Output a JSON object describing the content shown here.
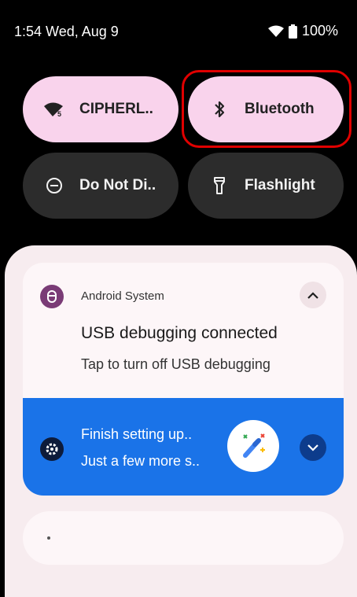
{
  "status_bar": {
    "time": "1:54 Wed, Aug 9",
    "battery": "100%",
    "icons": [
      "wifi-icon",
      "battery-icon"
    ]
  },
  "quick_settings": [
    {
      "label": "CIPHERL..",
      "icon": "wifi-icon",
      "state": "on"
    },
    {
      "label": "Bluetooth",
      "icon": "bluetooth-icon",
      "state": "on"
    },
    {
      "label": "Do Not Di..",
      "icon": "do-not-disturb-icon",
      "state": "off"
    },
    {
      "label": "Flashlight",
      "icon": "flashlight-icon",
      "state": "off"
    }
  ],
  "notifications": {
    "usb": {
      "app": "Android System",
      "title": "USB debugging connected",
      "body": "Tap to turn off USB debugging"
    },
    "setup": {
      "title": "Finish setting up..",
      "body": "Just a few more s.."
    }
  },
  "colors": {
    "tile_on": "#f9d3ec",
    "tile_off": "#2c2c2c",
    "accent_blue": "#1a73e8",
    "highlight": "#e00000"
  }
}
